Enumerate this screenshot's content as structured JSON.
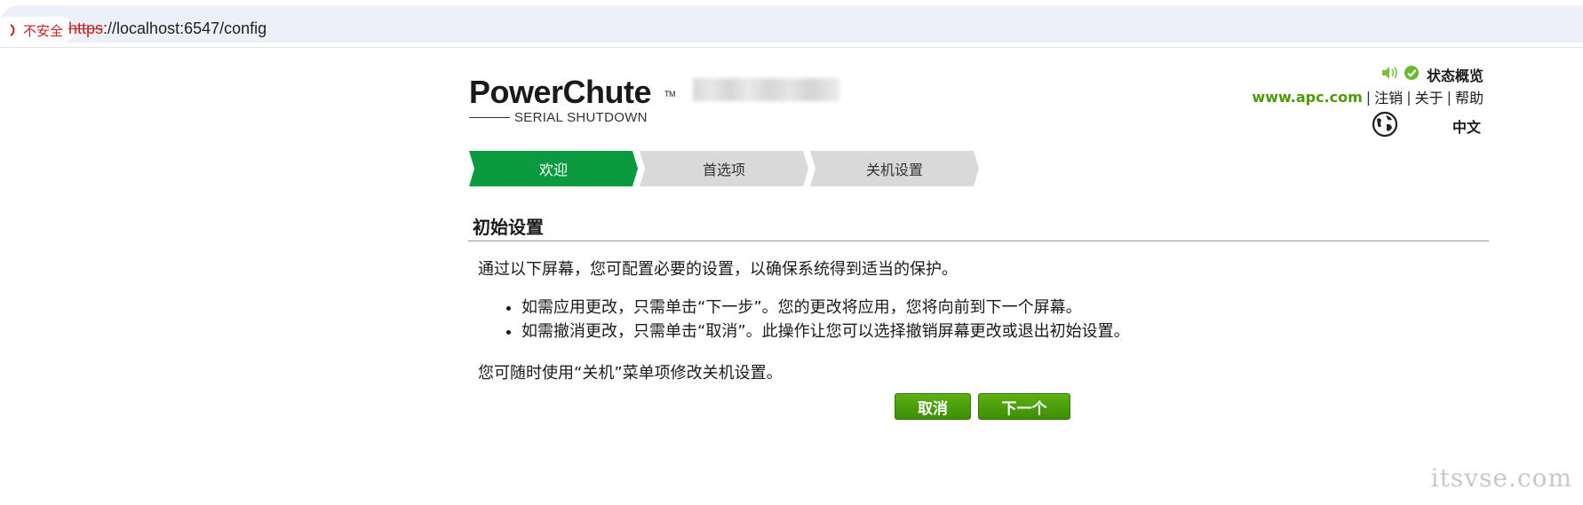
{
  "browser": {
    "security_label": "不安全",
    "url_scheme": "https",
    "url_rest": "://localhost:6547/config"
  },
  "logo": {
    "main": "PowerChute",
    "tm": "TM",
    "sub": "SERIAL SHUTDOWN"
  },
  "header": {
    "status_label": "状态概览",
    "apc_link": "www.apc.com",
    "logout": "注销",
    "about": "关于",
    "help": "帮助",
    "language": "中文",
    "separator": "|"
  },
  "steps": [
    {
      "label": "欢迎",
      "active": true
    },
    {
      "label": "首选项",
      "active": false
    },
    {
      "label": "关机设置",
      "active": false
    }
  ],
  "content": {
    "title": "初始设置",
    "intro": "通过以下屏幕，您可配置必要的设置，以确保系统得到适当的保护。",
    "bullets": [
      "如需应用更改，只需单击“下一步”。您的更改将应用，您将向前到下一个屏幕。",
      "如需撤消更改，只需单击“取消”。此操作让您可以选择撤销屏幕更改或退出初始设置。"
    ],
    "footer": "您可随时使用“关机”菜单项修改关机设置。"
  },
  "buttons": {
    "cancel": "取消",
    "next": "下一个"
  },
  "watermark": "itsvse.com",
  "colors": {
    "step_active": "#0c9a3f",
    "step_inactive": "#d9d9d9",
    "button_green": "#4a9d0a",
    "link_green": "#4e9a06",
    "insecure_red": "#c5221f"
  }
}
